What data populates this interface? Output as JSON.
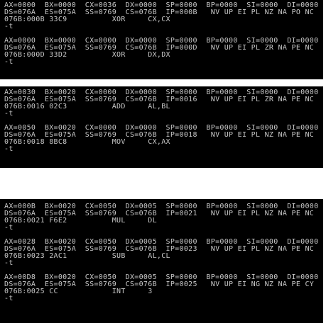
{
  "panels": [
    {
      "lines": [
        "AX=0000  BX=0000  CX=0036  DX=0000  SP=0000  BP=0000  SI=0000  DI=0000",
        "DS=076A  ES=075A  SS=0769  CS=076B  IP=000B   NV UP EI PL NZ NA PO NC",
        "076B:000B 33C9          XOR     CX,CX",
        "-t",
        "",
        "AX=0000  BX=0000  CX=0000  DX=0000  SP=0000  BP=0000  SI=0000  DI=0000",
        "DS=076A  ES=075A  SS=0769  CS=076B  IP=000D   NV UP EI PL ZR NA PE NC",
        "076B:000D 33D2          XOR     DX,DX",
        "-t"
      ]
    },
    {
      "lines": [
        "AX=0030  BX=0020  CX=0000  DX=0000  SP=0000  BP=0000  SI=0000  DI=0000",
        "DS=076A  ES=075A  SS=0769  CS=076B  IP=0016   NV UP EI PL ZR NA PE NC",
        "076B:0016 02C3          ADD     AL,BL",
        "-t",
        "",
        "AX=0050  BX=0020  CX=0000  DX=0000  SP=0000  BP=0000  SI=0000  DI=0000",
        "DS=076A  ES=075A  SS=0769  CS=076B  IP=0018   NV UP EI PL NZ NA PE NC",
        "076B:0018 8BC8          MOV     CX,AX",
        "-t"
      ]
    },
    {
      "lines": [
        "AX=000B  BX=0020  CX=0050  DX=0005  SP=0000  BP=0000  SI=0000  DI=0000",
        "DS=076A  ES=075A  SS=0769  CS=076B  IP=0021   NV UP EI PL NZ NA PE NC",
        "076B:0021 F6E2          MUL     DL",
        "-t",
        "",
        "AX=0028  BX=0020  CX=0050  DX=0005  SP=0000  BP=0000  SI=0000  DI=0000",
        "DS=076A  ES=075A  SS=0769  CS=076B  IP=0023   NV UP EI PL NZ NA PE NC",
        "076B:0023 2AC1          SUB     AL,CL",
        "-t",
        "",
        "AX=00D8  BX=0020  CX=0050  DX=0005  SP=0000  BP=0000  SI=0000  DI=0000",
        "DS=076A  ES=075A  SS=0769  CS=076B  IP=0025   NV UP EI NG NZ NA PE CY",
        "076B:0025 CC            INT     3",
        "-t"
      ]
    }
  ]
}
